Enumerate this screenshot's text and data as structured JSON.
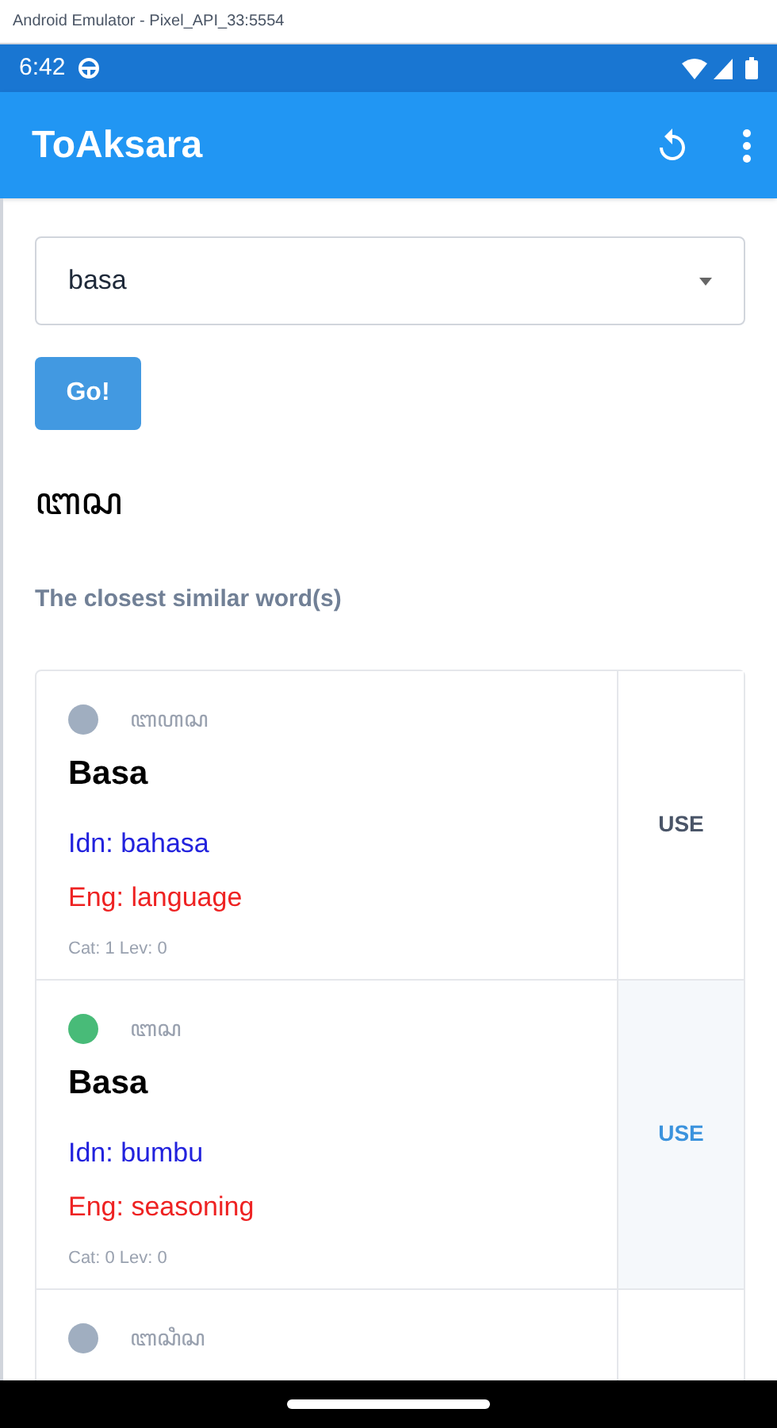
{
  "window": {
    "title": "Android Emulator - Pixel_API_33:5554"
  },
  "status_bar": {
    "time": "6:42"
  },
  "app_bar": {
    "title": "ToAksara"
  },
  "word_select": {
    "value": "basa"
  },
  "go_button": {
    "label": "Go!"
  },
  "result": {
    "script": "ꦧꦱ"
  },
  "section_heading": "The closest similar word(s)",
  "words": [
    {
      "script": "ꦧꦲꦱ",
      "color": "#a0aec0",
      "title": "Basa",
      "idn": "Idn: bahasa",
      "eng": "Eng: language",
      "meta": "Cat: 1 Lev: 0",
      "action": "USE",
      "selected": false
    },
    {
      "script": "ꦧꦱ",
      "color": "#48bb78",
      "title": "Basa",
      "idn": "Idn: bumbu",
      "eng": "Eng: seasoning",
      "meta": "Cat: 0 Lev: 0",
      "action": "USE",
      "selected": true
    },
    {
      "script": "ꦧꦱꦶꦱ",
      "color": "#a0aec0"
    }
  ]
}
